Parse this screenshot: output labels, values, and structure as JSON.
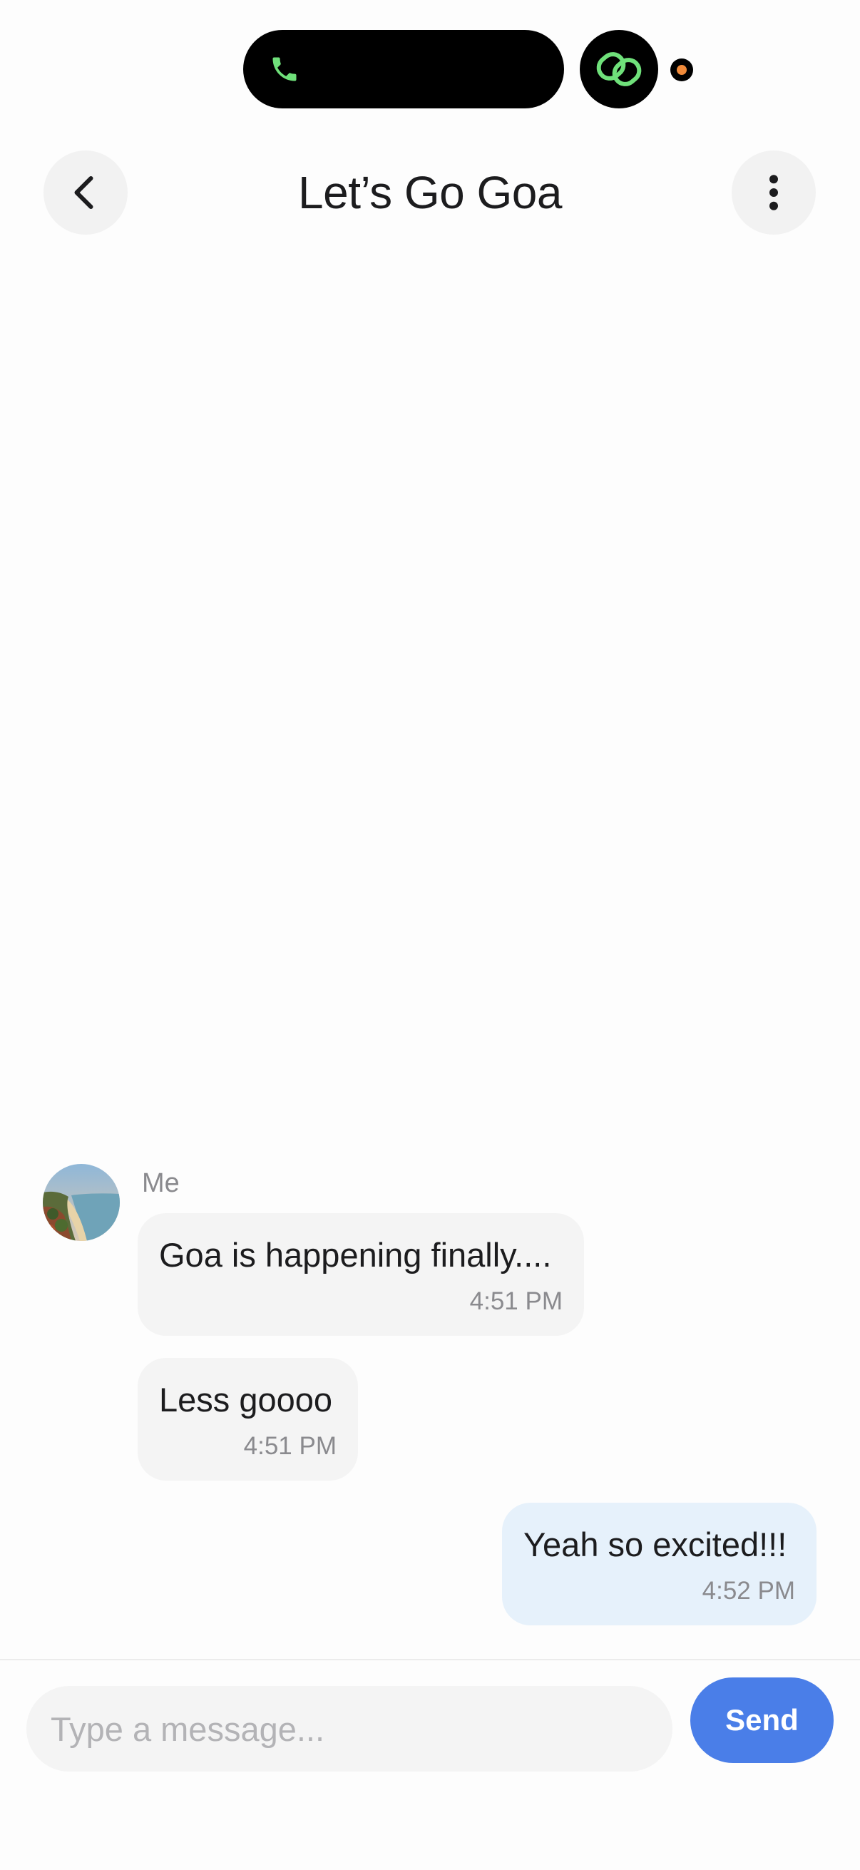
{
  "header": {
    "title": "Let’s Go Goa",
    "back_icon": "chevron-left-icon",
    "more_icon": "vertical-ellipsis-icon"
  },
  "status_bar": {
    "call_icon": "phone-icon",
    "app_icon": "linked-rings-icon",
    "accent_color": "#6fe07a",
    "indicator_color": "#f08a3a"
  },
  "messages": [
    {
      "sender": "Me",
      "direction": "incoming",
      "text": "Goa is happening finally....",
      "time": "4:51 PM"
    },
    {
      "sender": "Me",
      "direction": "incoming",
      "text": "Less goooo",
      "time": "4:51 PM"
    },
    {
      "sender": "",
      "direction": "outgoing",
      "text": "Yeah so excited!!!",
      "time": "4:52 PM"
    }
  ],
  "sender_label": "Me",
  "composer": {
    "placeholder": "Type a message...",
    "value": "",
    "send_label": "Send",
    "send_color": "#4a7ee8"
  },
  "colors": {
    "incoming_bubble": "#f4f4f4",
    "outgoing_bubble": "#e6f1fb",
    "timestamp": "#8a8a8e"
  }
}
